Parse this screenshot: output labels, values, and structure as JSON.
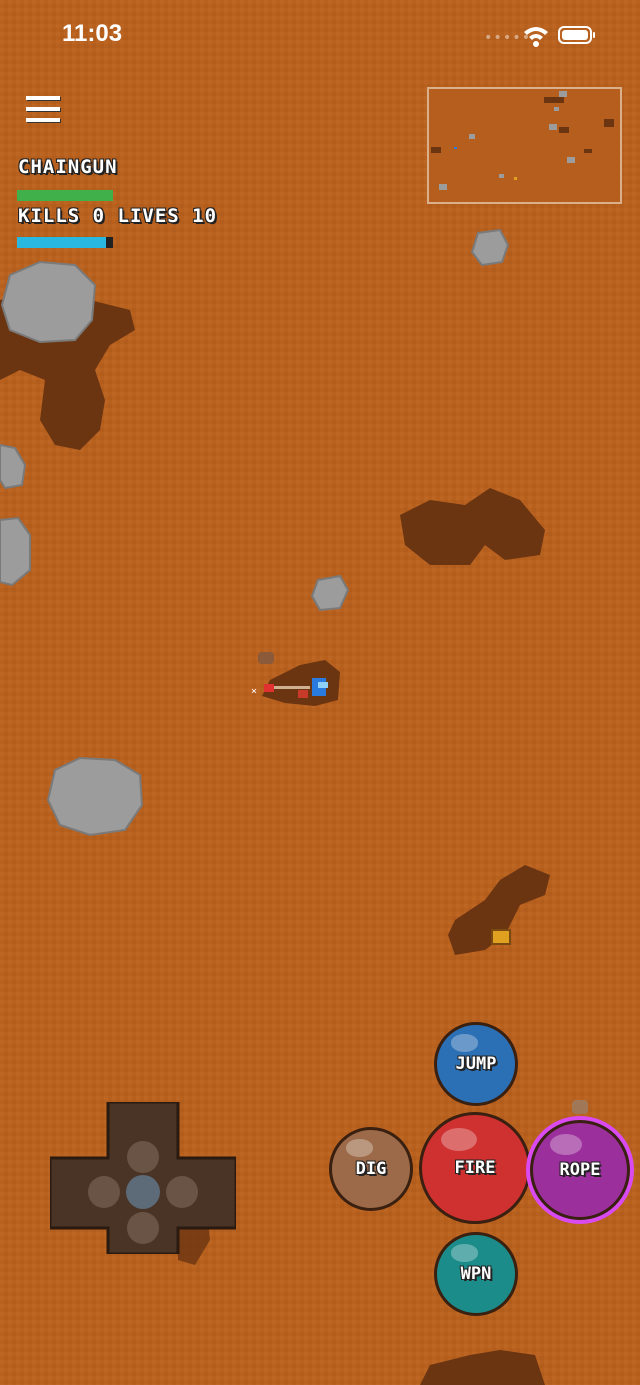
{
  "status_bar": {
    "time": "11:03",
    "signal": "•••••"
  },
  "hud": {
    "weapon_name": "CHAINGUN",
    "kills_lives": "KILLS 0 LIVES 10",
    "weapon_bar_fraction": 1.0,
    "health_bar_fraction": 0.93
  },
  "controls": {
    "jump": "JUMP",
    "dig": "DIG",
    "fire": "FIRE",
    "rope": "ROPE",
    "weapon": "WPN"
  },
  "colors": {
    "ground": "#b8611f",
    "tunnel": "#6b3512",
    "rock": "#9a9a9a",
    "weapon_bar": "#3fb04a",
    "health_bar": "#28b8e0",
    "jump_button": "#2b6fb4",
    "dig_button": "#9c6a48",
    "fire_button": "#cf3030",
    "rope_button": "#9b2f9b",
    "rope_ring": "#d94bf0",
    "wpn_button": "#1b8c8a"
  },
  "icons": [
    "hamburger-menu-icon",
    "wifi-icon",
    "battery-icon",
    "dpad-icon"
  ]
}
